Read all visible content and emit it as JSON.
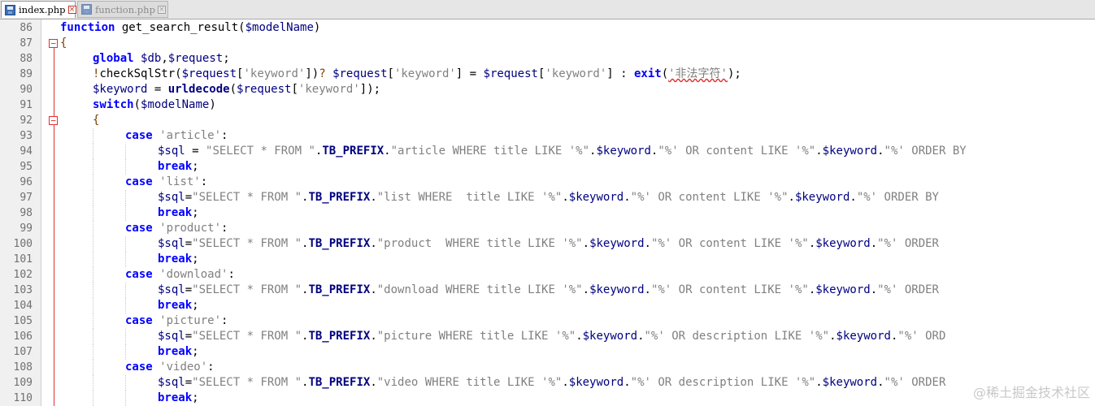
{
  "tabs": [
    {
      "label": "index.php",
      "active": true
    },
    {
      "label": "function.php",
      "active": false
    }
  ],
  "editor": {
    "lines": [
      {
        "num": "86",
        "indent": 0,
        "fold": "",
        "tokens": [
          [
            "kw",
            "function"
          ],
          [
            "punc",
            " get_search_result("
          ],
          [
            "var",
            "$modelName"
          ],
          [
            "punc",
            ")"
          ]
        ]
      },
      {
        "num": "87",
        "indent": 0,
        "fold": "−",
        "tokens": [
          [
            "op",
            "{"
          ]
        ]
      },
      {
        "num": "88",
        "indent": 1,
        "fold": "",
        "tokens": [
          [
            "kw",
            "global"
          ],
          [
            "punc",
            " "
          ],
          [
            "var",
            "$db"
          ],
          [
            "punc",
            ","
          ],
          [
            "var",
            "$request"
          ],
          [
            "punc",
            ";"
          ]
        ]
      },
      {
        "num": "89",
        "indent": 1,
        "fold": "",
        "tokens": [
          [
            "op",
            "!"
          ],
          [
            "punc",
            "checkSqlStr("
          ],
          [
            "var",
            "$request"
          ],
          [
            "punc",
            "["
          ],
          [
            "str",
            "'keyword'"
          ],
          [
            "punc",
            "])"
          ],
          [
            "op",
            "?"
          ],
          [
            "punc",
            " "
          ],
          [
            "var",
            "$request"
          ],
          [
            "punc",
            "["
          ],
          [
            "str",
            "'keyword'"
          ],
          [
            "punc",
            "] = "
          ],
          [
            "var",
            "$request"
          ],
          [
            "punc",
            "["
          ],
          [
            "str",
            "'keyword'"
          ],
          [
            "punc",
            "] : "
          ],
          [
            "kw",
            "exit"
          ],
          [
            "punc",
            "("
          ],
          [
            "str",
            "'非法字符'"
          ],
          [
            "punc",
            ");"
          ]
        ]
      },
      {
        "num": "90",
        "indent": 1,
        "fold": "",
        "tokens": [
          [
            "var",
            "$keyword"
          ],
          [
            "punc",
            " = "
          ],
          [
            "fn",
            "urldecode"
          ],
          [
            "punc",
            "("
          ],
          [
            "var",
            "$request"
          ],
          [
            "punc",
            "["
          ],
          [
            "str",
            "'keyword'"
          ],
          [
            "punc",
            "]);"
          ]
        ]
      },
      {
        "num": "91",
        "indent": 1,
        "fold": "",
        "tokens": [
          [
            "kw",
            "switch"
          ],
          [
            "punc",
            "("
          ],
          [
            "var",
            "$modelName"
          ],
          [
            "punc",
            ")"
          ]
        ]
      },
      {
        "num": "92",
        "indent": 1,
        "fold": "−",
        "tokens": [
          [
            "op",
            "{"
          ]
        ]
      },
      {
        "num": "93",
        "indent": 2,
        "fold": "",
        "tokens": [
          [
            "kw",
            "case"
          ],
          [
            "punc",
            " "
          ],
          [
            "str",
            "'article'"
          ],
          [
            "punc",
            ":"
          ]
        ]
      },
      {
        "num": "94",
        "indent": 3,
        "fold": "",
        "tokens": [
          [
            "var",
            "$sql"
          ],
          [
            "punc",
            " = "
          ],
          [
            "str",
            "\"SELECT * FROM \""
          ],
          [
            "punc",
            "."
          ],
          [
            "fn",
            "TB_PREFIX"
          ],
          [
            "punc",
            "."
          ],
          [
            "str",
            "\"article WHERE title LIKE '%\""
          ],
          [
            "punc",
            "."
          ],
          [
            "var",
            "$keyword"
          ],
          [
            "punc",
            "."
          ],
          [
            "str",
            "\"%' OR content LIKE '%\""
          ],
          [
            "punc",
            "."
          ],
          [
            "var",
            "$keyword"
          ],
          [
            "punc",
            "."
          ],
          [
            "str",
            "\"%' ORDER BY"
          ]
        ]
      },
      {
        "num": "95",
        "indent": 3,
        "fold": "",
        "tokens": [
          [
            "kw",
            "break"
          ],
          [
            "punc",
            ";"
          ]
        ]
      },
      {
        "num": "96",
        "indent": 2,
        "fold": "",
        "tokens": [
          [
            "kw",
            "case"
          ],
          [
            "punc",
            " "
          ],
          [
            "str",
            "'list'"
          ],
          [
            "punc",
            ":"
          ]
        ]
      },
      {
        "num": "97",
        "indent": 3,
        "fold": "",
        "tokens": [
          [
            "var",
            "$sql"
          ],
          [
            "punc",
            "="
          ],
          [
            "str",
            "\"SELECT * FROM \""
          ],
          [
            "punc",
            "."
          ],
          [
            "fn",
            "TB_PREFIX"
          ],
          [
            "punc",
            "."
          ],
          [
            "str",
            "\"list WHERE  title LIKE '%\""
          ],
          [
            "punc",
            "."
          ],
          [
            "var",
            "$keyword"
          ],
          [
            "punc",
            "."
          ],
          [
            "str",
            "\"%' OR content LIKE '%\""
          ],
          [
            "punc",
            "."
          ],
          [
            "var",
            "$keyword"
          ],
          [
            "punc",
            "."
          ],
          [
            "str",
            "\"%' ORDER BY"
          ]
        ]
      },
      {
        "num": "98",
        "indent": 3,
        "fold": "",
        "tokens": [
          [
            "kw",
            "break"
          ],
          [
            "punc",
            ";"
          ]
        ]
      },
      {
        "num": "99",
        "indent": 2,
        "fold": "",
        "tokens": [
          [
            "kw",
            "case"
          ],
          [
            "punc",
            " "
          ],
          [
            "str",
            "'product'"
          ],
          [
            "punc",
            ":"
          ]
        ]
      },
      {
        "num": "100",
        "indent": 3,
        "fold": "",
        "tokens": [
          [
            "var",
            "$sql"
          ],
          [
            "punc",
            "="
          ],
          [
            "str",
            "\"SELECT * FROM \""
          ],
          [
            "punc",
            "."
          ],
          [
            "fn",
            "TB_PREFIX"
          ],
          [
            "punc",
            "."
          ],
          [
            "str",
            "\"product  WHERE title LIKE '%\""
          ],
          [
            "punc",
            "."
          ],
          [
            "var",
            "$keyword"
          ],
          [
            "punc",
            "."
          ],
          [
            "str",
            "\"%' OR content LIKE '%\""
          ],
          [
            "punc",
            "."
          ],
          [
            "var",
            "$keyword"
          ],
          [
            "punc",
            "."
          ],
          [
            "str",
            "\"%' ORDER"
          ]
        ]
      },
      {
        "num": "101",
        "indent": 3,
        "fold": "",
        "tokens": [
          [
            "kw",
            "break"
          ],
          [
            "punc",
            ";"
          ]
        ]
      },
      {
        "num": "102",
        "indent": 2,
        "fold": "",
        "tokens": [
          [
            "kw",
            "case"
          ],
          [
            "punc",
            " "
          ],
          [
            "str",
            "'download'"
          ],
          [
            "punc",
            ":"
          ]
        ]
      },
      {
        "num": "103",
        "indent": 3,
        "fold": "",
        "tokens": [
          [
            "var",
            "$sql"
          ],
          [
            "punc",
            "="
          ],
          [
            "str",
            "\"SELECT * FROM \""
          ],
          [
            "punc",
            "."
          ],
          [
            "fn",
            "TB_PREFIX"
          ],
          [
            "punc",
            "."
          ],
          [
            "str",
            "\"download WHERE title LIKE '%\""
          ],
          [
            "punc",
            "."
          ],
          [
            "var",
            "$keyword"
          ],
          [
            "punc",
            "."
          ],
          [
            "str",
            "\"%' OR content LIKE '%\""
          ],
          [
            "punc",
            "."
          ],
          [
            "var",
            "$keyword"
          ],
          [
            "punc",
            "."
          ],
          [
            "str",
            "\"%' ORDER"
          ]
        ]
      },
      {
        "num": "104",
        "indent": 3,
        "fold": "",
        "tokens": [
          [
            "kw",
            "break"
          ],
          [
            "punc",
            ";"
          ]
        ]
      },
      {
        "num": "105",
        "indent": 2,
        "fold": "",
        "tokens": [
          [
            "kw",
            "case"
          ],
          [
            "punc",
            " "
          ],
          [
            "str",
            "'picture'"
          ],
          [
            "punc",
            ":"
          ]
        ]
      },
      {
        "num": "106",
        "indent": 3,
        "fold": "",
        "tokens": [
          [
            "var",
            "$sql"
          ],
          [
            "punc",
            "="
          ],
          [
            "str",
            "\"SELECT * FROM \""
          ],
          [
            "punc",
            "."
          ],
          [
            "fn",
            "TB_PREFIX"
          ],
          [
            "punc",
            "."
          ],
          [
            "str",
            "\"picture WHERE title LIKE '%\""
          ],
          [
            "punc",
            "."
          ],
          [
            "var",
            "$keyword"
          ],
          [
            "punc",
            "."
          ],
          [
            "str",
            "\"%' OR description LIKE '%\""
          ],
          [
            "punc",
            "."
          ],
          [
            "var",
            "$keyword"
          ],
          [
            "punc",
            "."
          ],
          [
            "str",
            "\"%' ORD"
          ]
        ]
      },
      {
        "num": "107",
        "indent": 3,
        "fold": "",
        "tokens": [
          [
            "kw",
            "break"
          ],
          [
            "punc",
            ";"
          ]
        ]
      },
      {
        "num": "108",
        "indent": 2,
        "fold": "",
        "tokens": [
          [
            "kw",
            "case"
          ],
          [
            "punc",
            " "
          ],
          [
            "str",
            "'video'"
          ],
          [
            "punc",
            ":"
          ]
        ]
      },
      {
        "num": "109",
        "indent": 3,
        "fold": "",
        "tokens": [
          [
            "var",
            "$sql"
          ],
          [
            "punc",
            "="
          ],
          [
            "str",
            "\"SELECT * FROM \""
          ],
          [
            "punc",
            "."
          ],
          [
            "fn",
            "TB_PREFIX"
          ],
          [
            "punc",
            "."
          ],
          [
            "str",
            "\"video WHERE title LIKE '%\""
          ],
          [
            "punc",
            "."
          ],
          [
            "var",
            "$keyword"
          ],
          [
            "punc",
            "."
          ],
          [
            "str",
            "\"%' OR description LIKE '%\""
          ],
          [
            "punc",
            "."
          ],
          [
            "var",
            "$keyword"
          ],
          [
            "punc",
            "."
          ],
          [
            "str",
            "\"%' ORDER"
          ]
        ]
      },
      {
        "num": "110",
        "indent": 3,
        "fold": "",
        "tokens": [
          [
            "kw",
            "break"
          ],
          [
            "punc",
            ";"
          ]
        ]
      }
    ]
  },
  "watermark": "@稀土掘金技术社区",
  "colors": {
    "keyword": "#0000ff",
    "function": "#000080",
    "variable": "#000080",
    "string": "#808080",
    "operator": "#804000",
    "fold_marker": "#e03030"
  }
}
